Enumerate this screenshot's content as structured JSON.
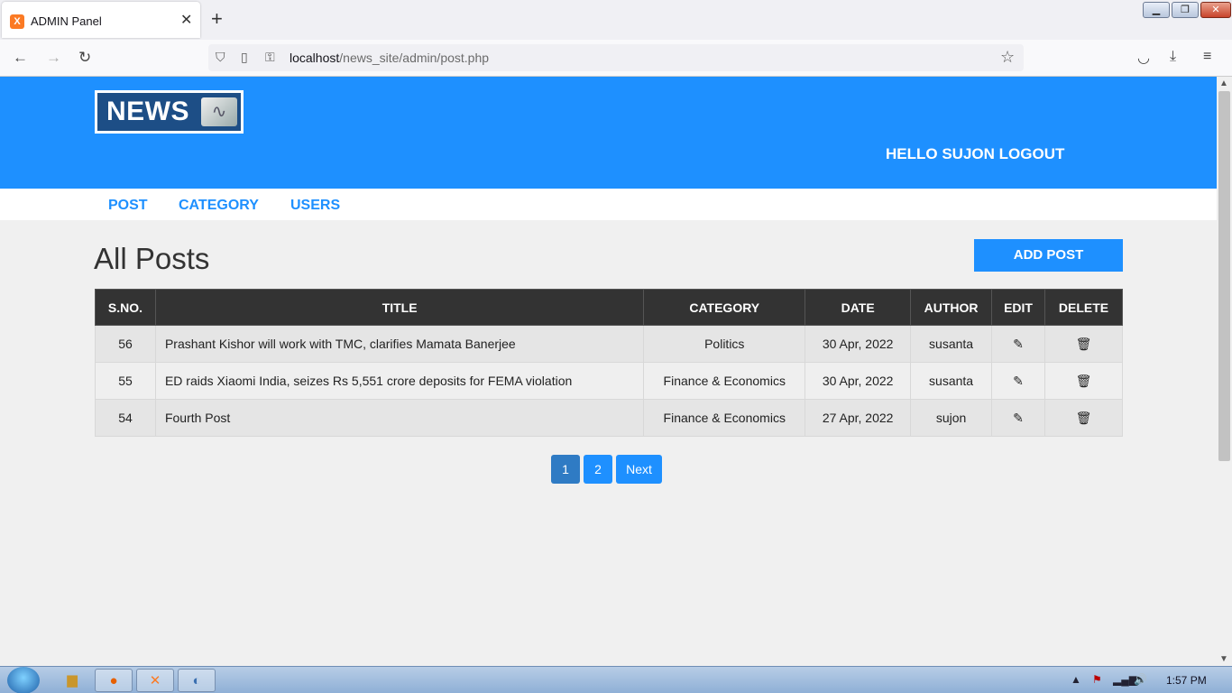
{
  "browser": {
    "tab_title": "ADMIN Panel",
    "tab_favicon": "X",
    "url_host": "localhost",
    "url_path": "/news_site/admin/post.php"
  },
  "site": {
    "logo_text": "NEWS",
    "greeting": "HELLO SUJON",
    "logout_label": "LOGOUT"
  },
  "menu": {
    "post": "POST",
    "category": "CATEGORY",
    "users": "USERS"
  },
  "page": {
    "title": "All Posts",
    "add_post_label": "ADD POST"
  },
  "table": {
    "headers": [
      "S.NO.",
      "TITLE",
      "CATEGORY",
      "DATE",
      "AUTHOR",
      "EDIT",
      "DELETE"
    ],
    "rows": [
      {
        "sno": "56",
        "title": "Prashant Kishor will work with TMC, clarifies Mamata Banerjee",
        "category": "Politics",
        "date": "30 Apr, 2022",
        "author": "susanta"
      },
      {
        "sno": "55",
        "title": "ED raids Xiaomi India, seizes Rs 5,551 crore deposits for FEMA violation",
        "category": "Finance & Economics",
        "date": "30 Apr, 2022",
        "author": "susanta"
      },
      {
        "sno": "54",
        "title": "Fourth Post",
        "category": "Finance & Economics",
        "date": "27 Apr, 2022",
        "author": "sujon"
      }
    ]
  },
  "pagination": {
    "page_1": "1",
    "page_2": "2",
    "next": "Next"
  },
  "taskbar": {
    "clock": "1:57 PM"
  },
  "colors": {
    "brand_blue": "#1e90ff",
    "table_header": "#333333"
  }
}
